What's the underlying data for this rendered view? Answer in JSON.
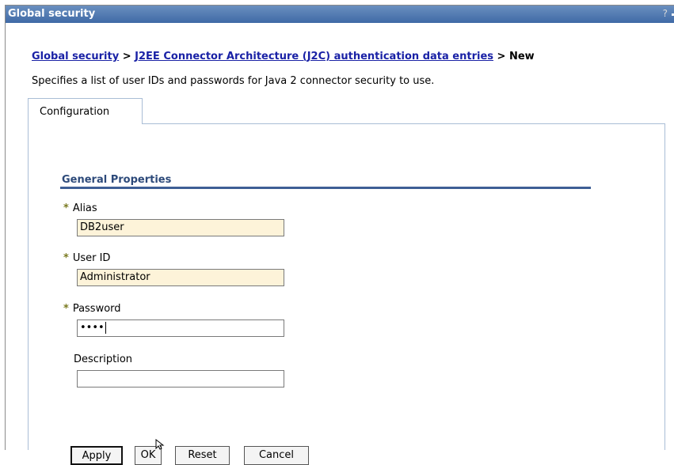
{
  "window": {
    "title": "Global security",
    "help": "?"
  },
  "breadcrumb": {
    "link1": "Global security",
    "sep1": ">",
    "link2": "J2EE Connector Architecture (J2C) authentication data entries",
    "sep2": ">",
    "current": "New"
  },
  "description": "Specifies a list of user IDs and passwords for Java 2 connector security to use.",
  "tabs": [
    {
      "label": "Configuration"
    }
  ],
  "section": {
    "title": "General Properties"
  },
  "fields": {
    "alias": {
      "label": "Alias",
      "value": "DB2user",
      "required": "*"
    },
    "userid": {
      "label": "User ID",
      "value": "Administrator",
      "required": "*"
    },
    "password": {
      "label": "Password",
      "value": "••••",
      "required": "*"
    },
    "description": {
      "label": "Description",
      "value": ""
    }
  },
  "buttons": {
    "apply": "Apply",
    "ok": "OK",
    "reset": "Reset",
    "cancel": "Cancel"
  }
}
